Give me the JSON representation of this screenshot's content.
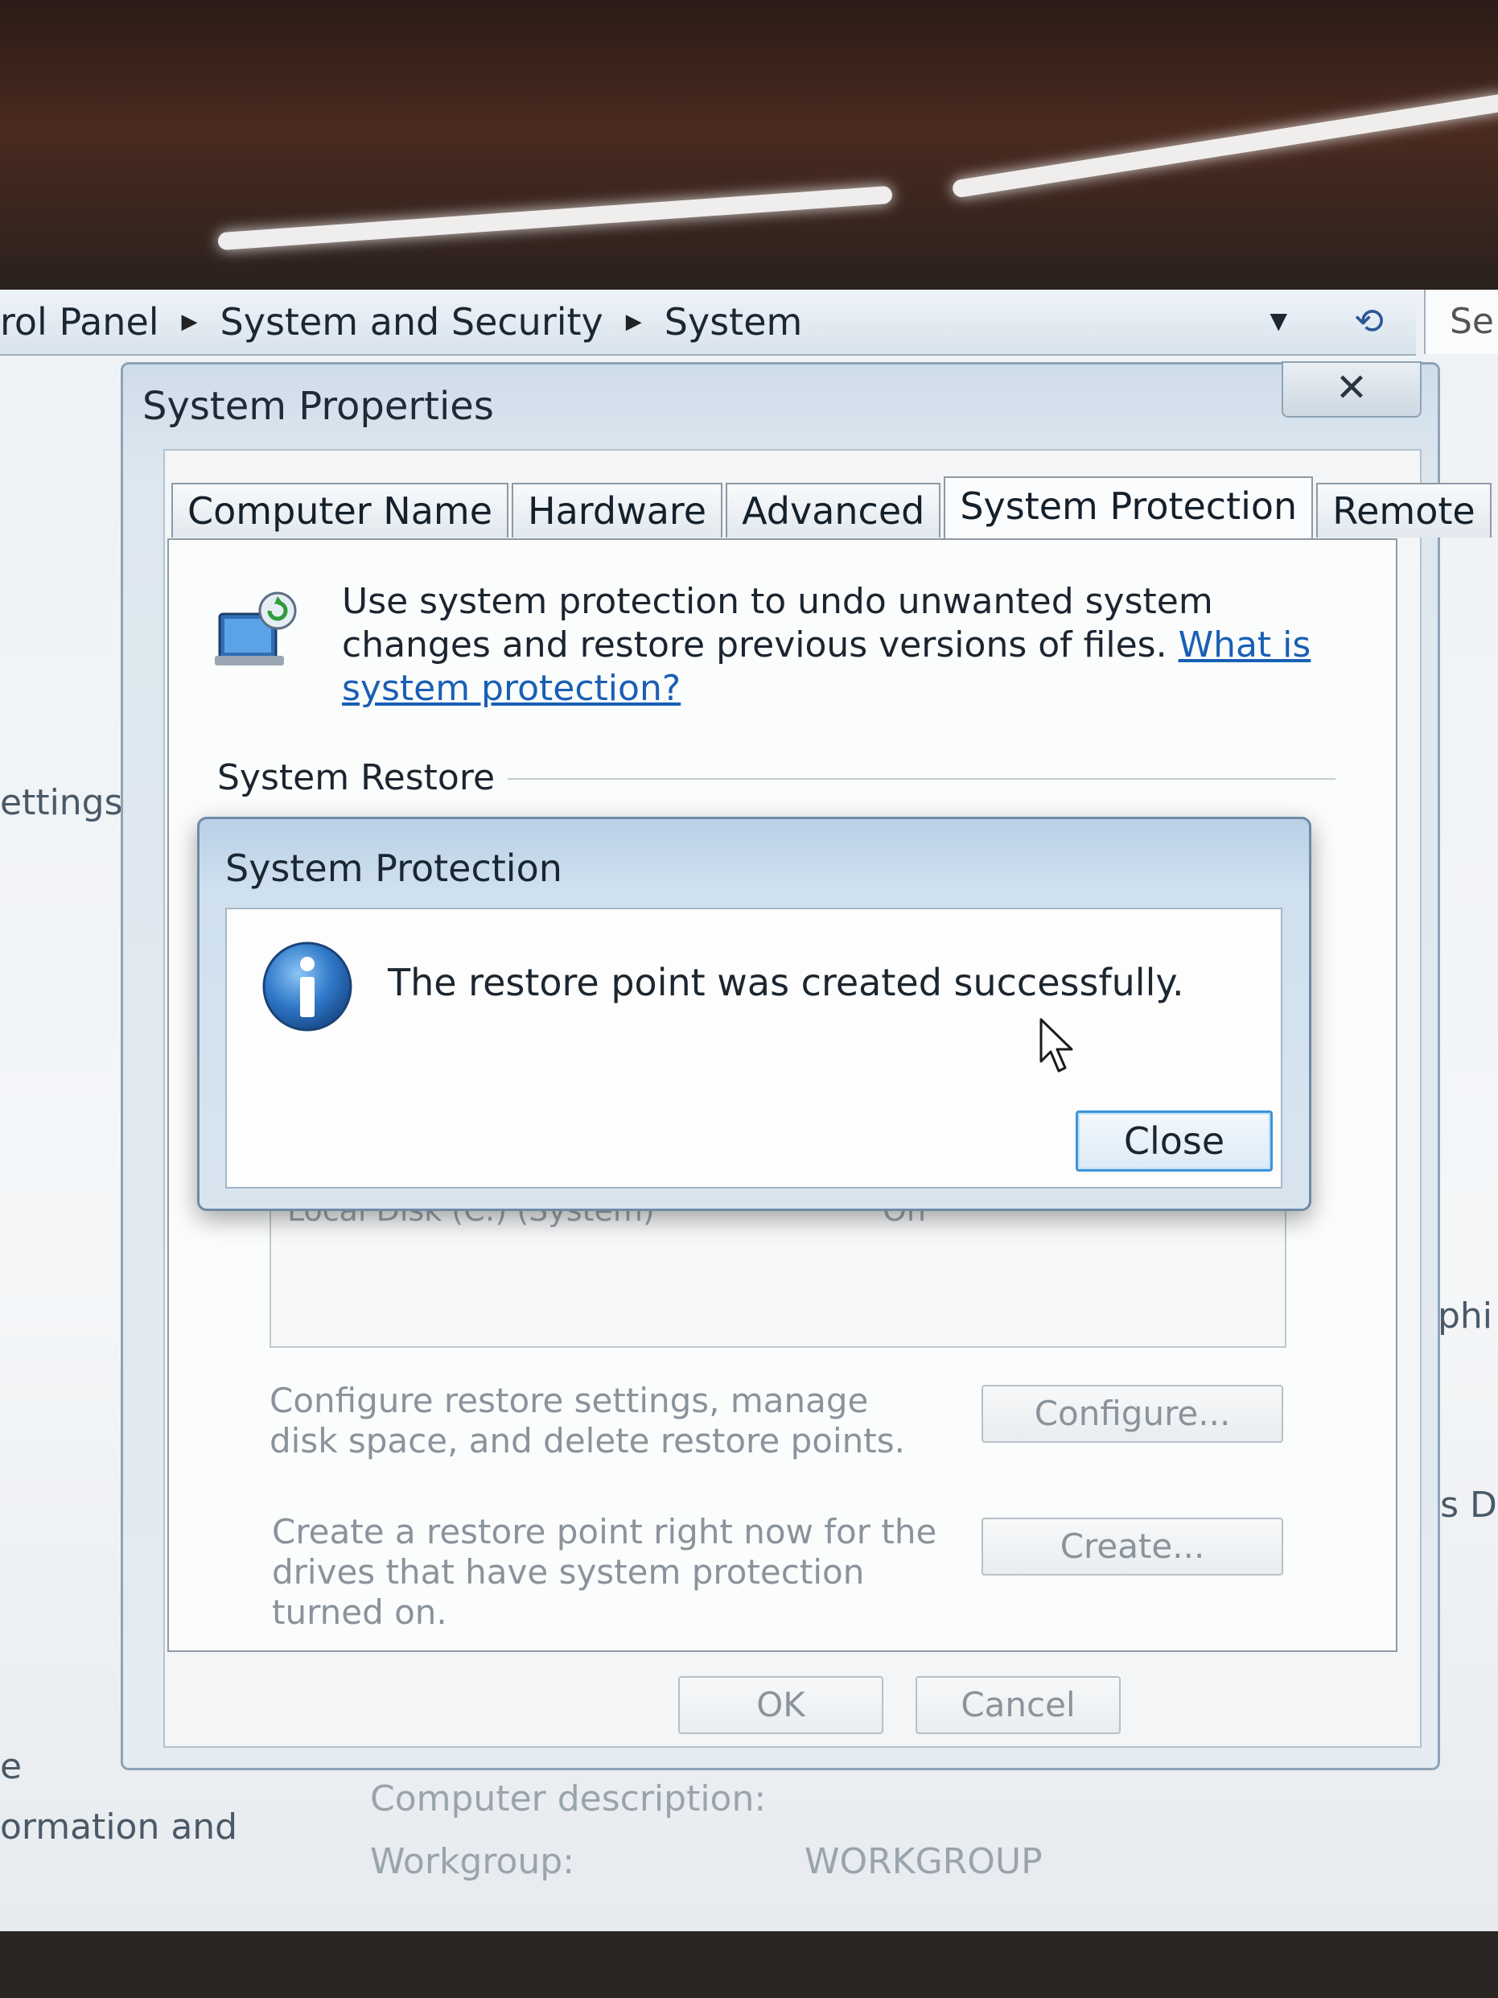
{
  "explorer": {
    "breadcrumb": [
      "rol Panel",
      "System and Security",
      "System"
    ],
    "search_partial": "Se"
  },
  "background": {
    "left_settings": "ettings",
    "left_e": "e",
    "left_info": "ormation and",
    "right_graphics": "aphi",
    "right_this": "his Di",
    "computer_description_label": "Computer description:",
    "workgroup_label": "Workgroup:",
    "workgroup_value": "WORKGROUP"
  },
  "system_properties": {
    "title": "System Properties",
    "close_glyph": "✕",
    "tabs": [
      "Computer Name",
      "Hardware",
      "Advanced",
      "System Protection",
      "Remote"
    ],
    "active_tab": "System Protection",
    "intro_text": "Use system protection to undo unwanted system changes and restore previous versions of files.",
    "intro_link": "What is system protection?",
    "system_restore_label": "System Restore",
    "drive_row": "Local Disk (C:) (System)",
    "drive_status": "On",
    "configure_desc": "Configure restore settings, manage disk space, and delete restore points.",
    "configure_button": "Configure...",
    "create_desc": "Create a restore point right now for the drives that have system protection turned on.",
    "create_button": "Create...",
    "ok_button": "OK",
    "cancel_button": "Cancel"
  },
  "message_box": {
    "title": "System Protection",
    "message": "The restore point was created successfully.",
    "close_button": "Close",
    "icon": "info-icon"
  },
  "colors": {
    "link": "#1a5fb4",
    "focus_border": "#3f94d9"
  }
}
